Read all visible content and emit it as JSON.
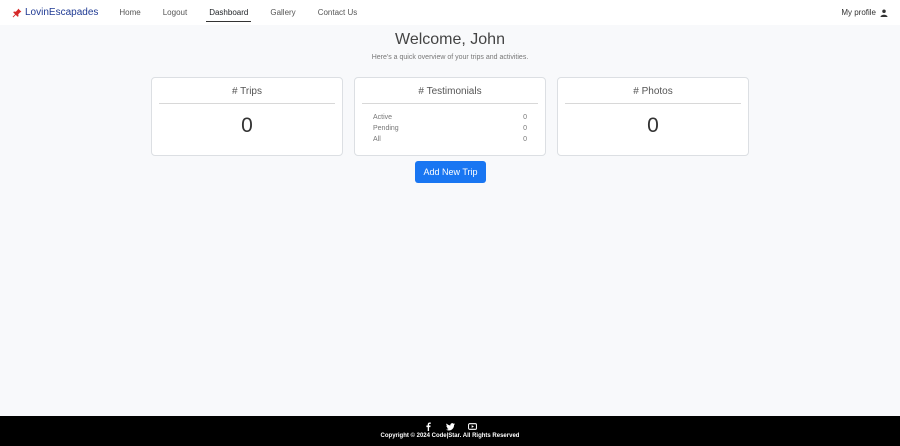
{
  "nav": {
    "brand": "LovinEscapades",
    "links": [
      "Home",
      "Logout",
      "Dashboard",
      "Gallery",
      "Contact Us"
    ],
    "active": "Dashboard",
    "profile": "My profile"
  },
  "welcome": {
    "title": "Welcome, John",
    "subtitle": "Here's a quick overview of your trips and activities."
  },
  "cards": {
    "trips": {
      "title": "# Trips",
      "value": "0"
    },
    "testimonials": {
      "title": "# Testimonials",
      "rows": [
        {
          "label": "Active",
          "value": "0"
        },
        {
          "label": "Pending",
          "value": "0"
        },
        {
          "label": "All",
          "value": "0"
        }
      ]
    },
    "photos": {
      "title": "# Photos",
      "value": "0"
    }
  },
  "actions": {
    "add_trip": "Add New Trip"
  },
  "footer": {
    "social_icons": [
      "facebook-icon",
      "twitter-icon",
      "youtube-icon"
    ],
    "copyright": "Copyright © 2024 Code|Star. All Rights Reserved"
  },
  "colors": {
    "primary": "#1976f2",
    "brand": "#1f3a93",
    "pin": "#d62828"
  }
}
